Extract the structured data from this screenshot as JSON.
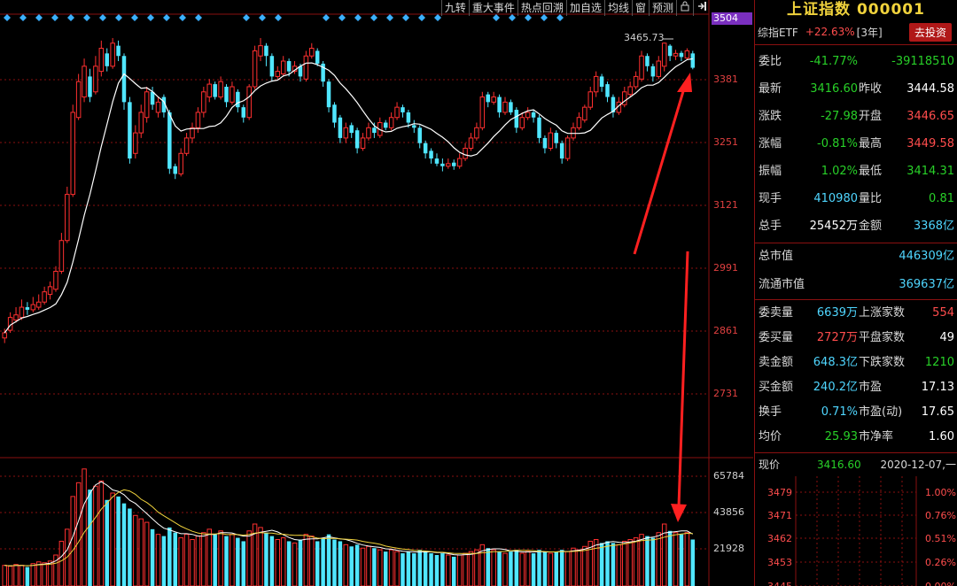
{
  "toolbar": [
    "九转",
    "重大事件",
    "热点回溯",
    "加自选",
    "均线",
    "窗",
    "预测"
  ],
  "icons": [
    "lock-icon",
    "exit-icon"
  ],
  "current_price_tag": "3504",
  "high_label": "3465.73",
  "price_axis": [
    "3381",
    "3251",
    "3121",
    "2991",
    "2861",
    "2731"
  ],
  "volume_axis": [
    "65784",
    "43856",
    "21928"
  ],
  "colors": {
    "up": "#ff3030",
    "down": "#50e6ff",
    "ma": "#ffffff",
    "arrow": "#ff2020",
    "panel_border": "#8a1010"
  },
  "chart_data": {
    "type": "candlestick",
    "y_range_price": [
      2660,
      3525
    ],
    "y_range_volume": [
      0,
      72000
    ],
    "candles": [
      [
        2900,
        2890,
        2908,
        2880,
        "u",
        12000
      ],
      [
        2930,
        2905,
        2940,
        2900,
        "u",
        11500
      ],
      [
        2935,
        2925,
        2950,
        2920,
        "u",
        12500
      ],
      [
        2950,
        2930,
        2965,
        2925,
        "u",
        12000
      ],
      [
        2945,
        2950,
        2960,
        2935,
        "d",
        11000
      ],
      [
        2955,
        2945,
        2970,
        2940,
        "u",
        13000
      ],
      [
        2960,
        2950,
        2975,
        2945,
        "u",
        14000
      ],
      [
        2980,
        2960,
        2990,
        2955,
        "u",
        13500
      ],
      [
        2990,
        2975,
        3000,
        2965,
        "u",
        14500
      ],
      [
        3020,
        2985,
        3030,
        2980,
        "u",
        18000
      ],
      [
        3080,
        3020,
        3095,
        3015,
        "u",
        26000
      ],
      [
        3170,
        3080,
        3185,
        3075,
        "u",
        33000
      ],
      [
        3330,
        3170,
        3345,
        3165,
        "u",
        52000
      ],
      [
        3390,
        3320,
        3405,
        3315,
        "u",
        60000
      ],
      [
        3420,
        3360,
        3435,
        3350,
        "u",
        68000
      ],
      [
        3360,
        3400,
        3415,
        3350,
        "d",
        56000
      ],
      [
        3420,
        3370,
        3440,
        3365,
        "u",
        58000
      ],
      [
        3455,
        3410,
        3470,
        3400,
        "u",
        61000
      ],
      [
        3420,
        3445,
        3455,
        3410,
        "d",
        50000
      ],
      [
        3465,
        3420,
        3475,
        3415,
        "u",
        54000
      ],
      [
        3440,
        3460,
        3470,
        3430,
        "d",
        52000
      ],
      [
        3350,
        3440,
        3445,
        3335,
        "d",
        48000
      ],
      [
        3240,
        3350,
        3360,
        3230,
        "d",
        45000
      ],
      [
        3290,
        3250,
        3305,
        3240,
        "u",
        41000
      ],
      [
        3330,
        3290,
        3345,
        3280,
        "u",
        39000
      ],
      [
        3370,
        3320,
        3380,
        3310,
        "u",
        37000
      ],
      [
        3345,
        3370,
        3380,
        3335,
        "d",
        33000
      ],
      [
        3350,
        3330,
        3360,
        3320,
        "u",
        30000
      ],
      [
        3330,
        3360,
        3365,
        3320,
        "d",
        29000
      ],
      [
        3220,
        3330,
        3335,
        3210,
        "d",
        34000
      ],
      [
        3210,
        3225,
        3230,
        3200,
        "d",
        31000
      ],
      [
        3250,
        3210,
        3260,
        3205,
        "u",
        28000
      ],
      [
        3280,
        3250,
        3290,
        3245,
        "u",
        30000
      ],
      [
        3300,
        3280,
        3310,
        3270,
        "u",
        27000
      ],
      [
        3330,
        3300,
        3340,
        3290,
        "u",
        29000
      ],
      [
        3370,
        3330,
        3380,
        3320,
        "u",
        31000
      ],
      [
        3385,
        3360,
        3395,
        3350,
        "u",
        33000
      ],
      [
        3360,
        3385,
        3390,
        3355,
        "d",
        30000
      ],
      [
        3390,
        3360,
        3400,
        3355,
        "u",
        32000
      ],
      [
        3350,
        3380,
        3385,
        3340,
        "d",
        29000
      ],
      [
        3380,
        3350,
        3390,
        3345,
        "u",
        30000
      ],
      [
        3340,
        3370,
        3375,
        3330,
        "d",
        28000
      ],
      [
        3320,
        3340,
        3345,
        3310,
        "d",
        26000
      ],
      [
        3380,
        3320,
        3385,
        3315,
        "u",
        32000
      ],
      [
        3450,
        3380,
        3460,
        3375,
        "u",
        36000
      ],
      [
        3460,
        3440,
        3475,
        3430,
        "u",
        34000
      ],
      [
        3440,
        3460,
        3465,
        3420,
        "d",
        31000
      ],
      [
        3400,
        3440,
        3445,
        3390,
        "d",
        29000
      ],
      [
        3410,
        3400,
        3420,
        3395,
        "u",
        27000
      ],
      [
        3430,
        3405,
        3440,
        3400,
        "u",
        28000
      ],
      [
        3410,
        3430,
        3435,
        3400,
        "d",
        26000
      ],
      [
        3420,
        3410,
        3430,
        3405,
        "u",
        25000
      ],
      [
        3400,
        3420,
        3425,
        3390,
        "d",
        27000
      ],
      [
        3440,
        3395,
        3450,
        3390,
        "u",
        30000
      ],
      [
        3455,
        3440,
        3465,
        3435,
        "u",
        29000
      ],
      [
        3425,
        3450,
        3455,
        3420,
        "d",
        26000
      ],
      [
        3390,
        3425,
        3430,
        3380,
        "d",
        28000
      ],
      [
        3340,
        3390,
        3395,
        3330,
        "d",
        30000
      ],
      [
        3310,
        3345,
        3350,
        3300,
        "d",
        27000
      ],
      [
        3280,
        3320,
        3325,
        3270,
        "d",
        26000
      ],
      [
        3300,
        3280,
        3310,
        3270,
        "u",
        24000
      ],
      [
        3290,
        3305,
        3310,
        3280,
        "d",
        23000
      ],
      [
        3260,
        3295,
        3300,
        3250,
        "d",
        24000
      ],
      [
        3280,
        3260,
        3290,
        3255,
        "u",
        22000
      ],
      [
        3300,
        3280,
        3310,
        3275,
        "u",
        23000
      ],
      [
        3290,
        3300,
        3310,
        3280,
        "d",
        22000
      ],
      [
        3310,
        3285,
        3320,
        3280,
        "u",
        21000
      ],
      [
        3300,
        3310,
        3315,
        3295,
        "d",
        20000
      ],
      [
        3320,
        3300,
        3330,
        3295,
        "u",
        21000
      ],
      [
        3340,
        3320,
        3350,
        3315,
        "u",
        20000
      ],
      [
        3330,
        3340,
        3345,
        3320,
        "d",
        19000
      ],
      [
        3310,
        3330,
        3335,
        3300,
        "d",
        20000
      ],
      [
        3300,
        3305,
        3315,
        3290,
        "d",
        19000
      ],
      [
        3270,
        3300,
        3305,
        3260,
        "d",
        21000
      ],
      [
        3250,
        3270,
        3275,
        3240,
        "d",
        20000
      ],
      [
        3240,
        3255,
        3260,
        3230,
        "d",
        19000
      ],
      [
        3230,
        3240,
        3250,
        3225,
        "d",
        18000
      ],
      [
        3225,
        3230,
        3240,
        3215,
        "d",
        19000
      ],
      [
        3230,
        3225,
        3240,
        3220,
        "u",
        18000
      ],
      [
        3225,
        3232,
        3238,
        3218,
        "d",
        17000
      ],
      [
        3240,
        3225,
        3250,
        3220,
        "u",
        18000
      ],
      [
        3260,
        3240,
        3270,
        3235,
        "u",
        19000
      ],
      [
        3280,
        3260,
        3290,
        3255,
        "u",
        20000
      ],
      [
        3300,
        3280,
        3310,
        3275,
        "u",
        21000
      ],
      [
        3360,
        3300,
        3370,
        3295,
        "u",
        24000
      ],
      [
        3350,
        3365,
        3370,
        3340,
        "d",
        22000
      ],
      [
        3360,
        3350,
        3370,
        3345,
        "u",
        21000
      ],
      [
        3330,
        3360,
        3365,
        3320,
        "d",
        20000
      ],
      [
        3350,
        3330,
        3360,
        3325,
        "u",
        19000
      ],
      [
        3330,
        3350,
        3355,
        3325,
        "d",
        20000
      ],
      [
        3300,
        3335,
        3340,
        3290,
        "d",
        21000
      ],
      [
        3320,
        3300,
        3330,
        3295,
        "u",
        19000
      ],
      [
        3330,
        3320,
        3340,
        3315,
        "u",
        20000
      ],
      [
        3320,
        3330,
        3335,
        3310,
        "d",
        19000
      ],
      [
        3280,
        3320,
        3325,
        3270,
        "d",
        21000
      ],
      [
        3260,
        3280,
        3285,
        3250,
        "d",
        20000
      ],
      [
        3290,
        3260,
        3300,
        3255,
        "u",
        19000
      ],
      [
        3270,
        3290,
        3295,
        3260,
        "d",
        20000
      ],
      [
        3240,
        3270,
        3275,
        3230,
        "d",
        21000
      ],
      [
        3280,
        3240,
        3285,
        3235,
        "u",
        20000
      ],
      [
        3300,
        3280,
        3310,
        3275,
        "u",
        22000
      ],
      [
        3320,
        3300,
        3330,
        3295,
        "u",
        21000
      ],
      [
        3340,
        3315,
        3345,
        3310,
        "u",
        23000
      ],
      [
        3370,
        3340,
        3380,
        3335,
        "u",
        26000
      ],
      [
        3400,
        3370,
        3410,
        3360,
        "u",
        27000
      ],
      [
        3380,
        3400,
        3405,
        3370,
        "d",
        25000
      ],
      [
        3360,
        3385,
        3390,
        3350,
        "d",
        26000
      ],
      [
        3330,
        3360,
        3365,
        3320,
        "d",
        25000
      ],
      [
        3350,
        3330,
        3360,
        3325,
        "u",
        24000
      ],
      [
        3370,
        3345,
        3380,
        3340,
        "u",
        26000
      ],
      [
        3380,
        3365,
        3390,
        3360,
        "u",
        27000
      ],
      [
        3400,
        3380,
        3410,
        3375,
        "u",
        28000
      ],
      [
        3440,
        3395,
        3450,
        3390,
        "u",
        30000
      ],
      [
        3420,
        3440,
        3445,
        3410,
        "d",
        29000
      ],
      [
        3400,
        3420,
        3425,
        3390,
        "d",
        28000
      ],
      [
        3430,
        3400,
        3440,
        3395,
        "u",
        31000
      ],
      [
        3465,
        3420,
        3466,
        3410,
        "u",
        36000
      ],
      [
        3440,
        3460,
        3463,
        3430,
        "d",
        32000
      ],
      [
        3445,
        3440,
        3452,
        3432,
        "u",
        31000
      ],
      [
        3438,
        3446,
        3450,
        3430,
        "d",
        30000
      ],
      [
        3450,
        3436,
        3455,
        3432,
        "u",
        31000
      ],
      [
        3417,
        3445,
        3450,
        3414,
        "d",
        27000
      ]
    ]
  },
  "panel": {
    "title": "上证指数 000001",
    "etf_label": "综指ETF",
    "etf_value": "+22.63%",
    "etf_period": "[3年]",
    "etf_button": "去投资",
    "rows": [
      {
        "k1": "委比",
        "v1": "-41.77%",
        "c1": "green",
        "k2": "",
        "v2": "-39118510",
        "c2": "green"
      },
      {
        "k1": "最新",
        "v1": "3416.60",
        "c1": "green",
        "k2": "昨收",
        "v2": "3444.58",
        "c2": "white"
      },
      {
        "k1": "涨跌",
        "v1": "-27.98",
        "c1": "green",
        "k2": "开盘",
        "v2": "3446.65",
        "c2": "red"
      },
      {
        "k1": "涨幅",
        "v1": "-0.81%",
        "c1": "green",
        "k2": "最高",
        "v2": "3449.58",
        "c2": "red"
      },
      {
        "k1": "振幅",
        "v1": "1.02%",
        "c1": "green",
        "k2": "最低",
        "v2": "3414.31",
        "c2": "green"
      },
      {
        "k1": "现手",
        "v1": "410980",
        "c1": "cyan",
        "k2": "量比",
        "v2": "0.81",
        "c2": "green"
      },
      {
        "k1": "总手",
        "v1": "25452万",
        "c1": "white",
        "k2": "金额",
        "v2": "3368亿",
        "c2": "cyan"
      }
    ],
    "cap_rows": [
      {
        "k": "总市值",
        "v": "446309亿"
      },
      {
        "k": "流通市值",
        "v": "369637亿"
      }
    ],
    "order_rows": [
      {
        "k1": "委卖量",
        "v1": "6639万",
        "c1": "cyan",
        "k2": "上涨家数",
        "v2": "554",
        "c2": "red"
      },
      {
        "k1": "委买量",
        "v1": "2727万",
        "c1": "red",
        "k2": "平盘家数",
        "v2": "49",
        "c2": "white"
      },
      {
        "k1": "卖金额",
        "v1": "648.3亿",
        "c1": "cyan",
        "k2": "下跌家数",
        "v2": "1210",
        "c2": "green"
      },
      {
        "k1": "买金额",
        "v1": "240.2亿",
        "c1": "cyan",
        "k2": "市盈",
        "v2": "17.13",
        "c2": "white"
      },
      {
        "k1": "换手",
        "v1": "0.71%",
        "c1": "cyan",
        "k2": "市盈(动)",
        "v2": "17.65",
        "c2": "white"
      },
      {
        "k1": "均价",
        "v1": "25.93",
        "c1": "green",
        "k2": "市净率",
        "v2": "1.60",
        "c2": "white"
      }
    ],
    "now_label": "现价",
    "now_value": "3416.60",
    "now_date": "2020-12-07,一",
    "mini_left": [
      "3479",
      "3471",
      "3462",
      "3453",
      "3445"
    ],
    "mini_right": [
      "1.00%",
      "0.76%",
      "0.51%",
      "0.26%",
      "0.00%"
    ]
  }
}
